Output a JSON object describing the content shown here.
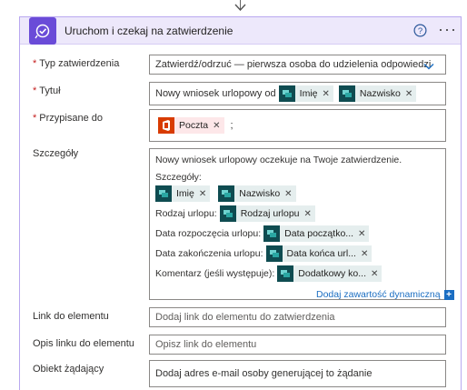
{
  "card": {
    "title": "Uruchom i czekaj na zatwierdzenie",
    "help_icon": "question-circle-icon",
    "more_label": "···"
  },
  "fields": {
    "approval_type": {
      "label": "Typ zatwierdzenia",
      "value": "Zatwierdź/odrzuć — pierwsza osoba do udzielenia odpowiedzi"
    },
    "title": {
      "label": "Tytuł",
      "prefix": "Nowy wniosek urlopowy od",
      "tokens": [
        "Imię",
        "Nazwisko"
      ]
    },
    "assigned_to": {
      "label": "Przypisane do",
      "token": "Poczta",
      "suffix": ";"
    },
    "details": {
      "label": "Szczegóły",
      "intro": "Nowy wniosek urlopowy oczekuje na Twoje zatwierdzenie.",
      "heading": "Szczegóły:",
      "tokens_row": [
        "Imię",
        "Nazwisko"
      ],
      "leave_type_label": "Rodzaj urlopu:",
      "leave_type_token": "Rodzaj urlopu",
      "start_label": "Data rozpoczęcia urlopu:",
      "start_token": "Data początko...",
      "end_label": "Data zakończenia urlopu:",
      "end_token": "Data końca url...",
      "comment_label": "Komentarz (jeśli występuje):",
      "comment_token": "Dodatkowy ko..."
    },
    "dynamic_content_link": "Dodaj zawartość dynamiczną",
    "item_link": {
      "label": "Link do elementu",
      "placeholder": "Dodaj link do elementu do zatwierdzenia"
    },
    "item_link_desc": {
      "label": "Opis linku do elementu",
      "placeholder": "Opisz link do elementu"
    },
    "requestor": {
      "label": "Obiekt żądający",
      "placeholder": "Dodaj adres e-mail osoby generującej to żądanie"
    }
  },
  "colors": {
    "header_bg": "#ede8fb",
    "app_icon_bg": "#6a4bd8",
    "token_bg": "#e5eeee",
    "token_icon_bg": "#0f4c51",
    "office_icon_bg": "#d83b01",
    "link": "#1b6ec2",
    "required": "#c41e1e"
  }
}
